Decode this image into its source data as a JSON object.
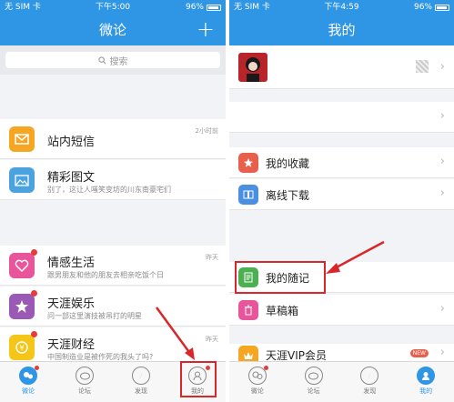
{
  "left": {
    "status": {
      "carrier": "无 SIM 卡",
      "time": "下午5:00",
      "battery": "96%"
    },
    "nav": {
      "title": "微论",
      "add_label": "+"
    },
    "search": {
      "placeholder": "搜索"
    },
    "rows": [
      {
        "title": "站内短信",
        "sub": "",
        "time": "2小时前",
        "icon": "mail-icon",
        "color": "#f5a623"
      },
      {
        "title": "精彩图文",
        "sub": "别了，这让人嗤笑变坊的川东南豪宅们",
        "time": "",
        "icon": "image-icon",
        "color": "#4aa3df"
      },
      {
        "title": "情感生活",
        "sub": "跟男朋友和他的朋友去相亲吃饭个日",
        "time": "昨天",
        "icon": "heart-icon",
        "color": "#e8559a"
      },
      {
        "title": "天涯娱乐",
        "sub": "问一部这里演技被吊打的明星",
        "time": "",
        "icon": "star-icon",
        "color": "#9b59b6"
      },
      {
        "title": "天涯财经",
        "sub": "中国制造业是被作死的我头了吗?",
        "time": "昨天",
        "icon": "coin-icon",
        "color": "#f5c518"
      }
    ],
    "tabs": [
      {
        "label": "微论",
        "icon": "chat-icon"
      },
      {
        "label": "论坛",
        "icon": "forum-icon"
      },
      {
        "label": "发现",
        "icon": "compass-icon"
      },
      {
        "label": "我的",
        "icon": "user-icon"
      }
    ]
  },
  "right": {
    "status": {
      "carrier": "无 SIM 卡",
      "time": "下午4:59",
      "battery": "96%"
    },
    "nav": {
      "title": "我的"
    },
    "menu": [
      {
        "label": "我的收藏",
        "icon": "favorite-icon",
        "color": "#e8604c"
      },
      {
        "label": "离线下载",
        "icon": "book-icon",
        "color": "#4a90e2"
      },
      {
        "label": "我的随记",
        "icon": "note-icon",
        "color": "#4caf50"
      },
      {
        "label": "草稿箱",
        "icon": "trash-icon",
        "color": "#e8559a"
      },
      {
        "label": "天涯VIP会员",
        "icon": "vip-icon",
        "color": "#f5a623",
        "badge": "NEW"
      }
    ],
    "tabs": [
      {
        "label": "微论",
        "icon": "chat-icon"
      },
      {
        "label": "论坛",
        "icon": "forum-icon"
      },
      {
        "label": "发现",
        "icon": "compass-icon"
      },
      {
        "label": "我的",
        "icon": "user-icon"
      }
    ]
  },
  "colors": {
    "accent": "#2f96e6",
    "annotation": "#d9262b"
  }
}
